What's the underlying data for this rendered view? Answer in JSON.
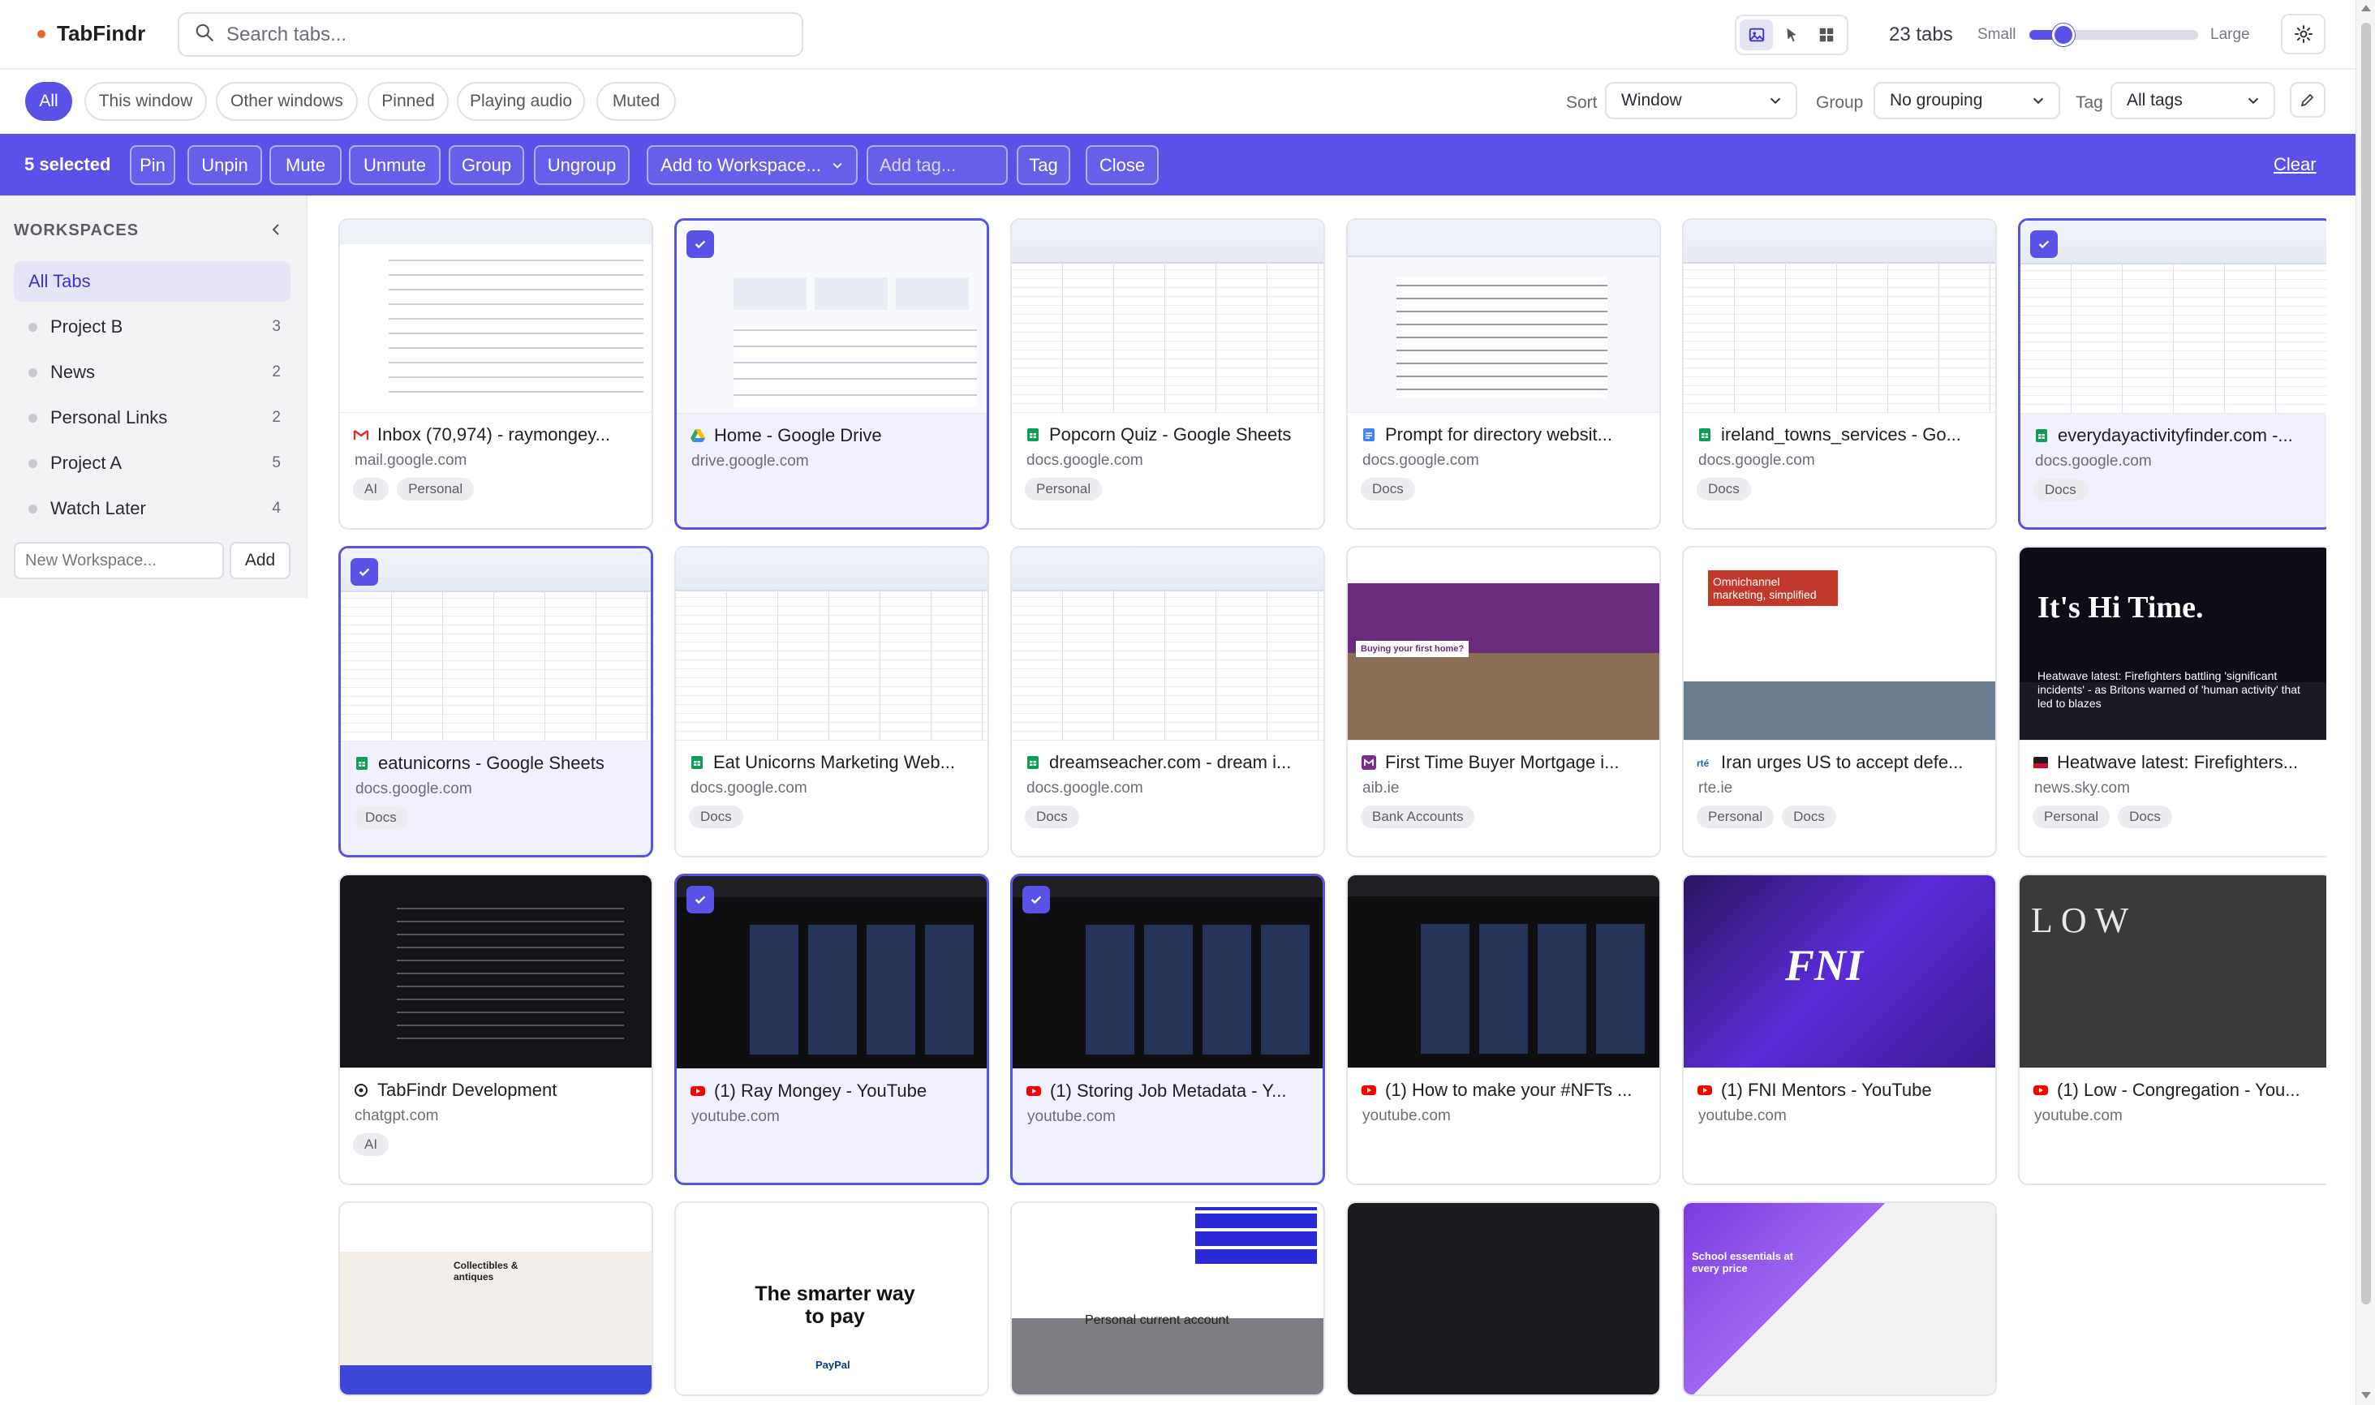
{
  "app": {
    "name": "TabFindr",
    "accent": "#5a52e6"
  },
  "search": {
    "placeholder": "Search tabs..."
  },
  "header": {
    "tab_count": "23 tabs",
    "size_small": "Small",
    "size_large": "Large",
    "size_level": 0.2
  },
  "filters": {
    "chips": [
      "All",
      "This window",
      "Other windows",
      "Pinned",
      "Playing audio",
      "Muted"
    ],
    "active_chip": "All",
    "sort_label": "Sort",
    "sort_value": "Window",
    "group_label": "Group",
    "group_value": "No grouping",
    "tag_label": "Tag",
    "tag_value": "All tags"
  },
  "selection": {
    "count_label": "5 selected",
    "actions": [
      "Pin",
      "Unpin",
      "Mute",
      "Unmute",
      "Group",
      "Ungroup"
    ],
    "workspace_dropdown": "Add to Workspace...",
    "tag_placeholder": "Add tag...",
    "tag_button": "Tag",
    "close_button": "Close",
    "clear_link": "Clear"
  },
  "sidebar": {
    "heading": "WORKSPACES",
    "items": [
      {
        "label": "All Tabs",
        "count": ""
      },
      {
        "label": "Project B",
        "count": "3"
      },
      {
        "label": "News",
        "count": "2"
      },
      {
        "label": "Personal Links",
        "count": "2"
      },
      {
        "label": "Project A",
        "count": "5"
      },
      {
        "label": "Watch Later",
        "count": "4"
      }
    ],
    "new_placeholder": "New Workspace...",
    "add_button": "Add"
  },
  "tabs": [
    {
      "title": "Inbox (70,974) - raymongey...",
      "domain": "mail.google.com",
      "tags": [
        "AI",
        "Personal"
      ],
      "selected": false,
      "favicon": "gmail-icon",
      "thumb": "mail"
    },
    {
      "title": "Home - Google Drive",
      "domain": "drive.google.com",
      "tags": [],
      "selected": true,
      "favicon": "google-drive-icon",
      "thumb": "drive"
    },
    {
      "title": "Popcorn Quiz - Google Sheets",
      "domain": "docs.google.com",
      "tags": [
        "Personal"
      ],
      "selected": false,
      "favicon": "google-sheets-icon",
      "thumb": "sheet"
    },
    {
      "title": "Prompt for directory websit...",
      "domain": "docs.google.com",
      "tags": [
        "Docs"
      ],
      "selected": false,
      "favicon": "google-docs-icon",
      "thumb": "doc"
    },
    {
      "title": "ireland_towns_services - Go...",
      "domain": "docs.google.com",
      "tags": [
        "Docs"
      ],
      "selected": false,
      "favicon": "google-sheets-icon",
      "thumb": "sheet"
    },
    {
      "title": "everydayactivityfinder.com -...",
      "domain": "docs.google.com",
      "tags": [
        "Docs"
      ],
      "selected": true,
      "favicon": "google-sheets-icon",
      "thumb": "sheet"
    },
    {
      "title": "eatunicorns - Google Sheets",
      "domain": "docs.google.com",
      "tags": [
        "Docs"
      ],
      "selected": true,
      "favicon": "google-sheets-icon",
      "thumb": "sheet"
    },
    {
      "title": "Eat Unicorns Marketing Web...",
      "domain": "docs.google.com",
      "tags": [
        "Docs"
      ],
      "selected": false,
      "favicon": "google-sheets-icon",
      "thumb": "sheet"
    },
    {
      "title": "dreamseacher.com - dream i...",
      "domain": "docs.google.com",
      "tags": [
        "Docs"
      ],
      "selected": false,
      "favicon": "google-sheets-icon",
      "thumb": "sheet"
    },
    {
      "title": "First Time Buyer Mortgage i...",
      "domain": "aib.ie",
      "tags": [
        "Bank Accounts"
      ],
      "selected": false,
      "favicon": "aib-icon",
      "thumb": "bank"
    },
    {
      "title": "Iran urges US to accept defe...",
      "domain": "rte.ie",
      "tags": [
        "Personal",
        "Docs"
      ],
      "selected": false,
      "favicon": "rte-icon",
      "thumb": "news"
    },
    {
      "title": "Heatwave latest: Firefighters...",
      "domain": "news.sky.com",
      "tags": [
        "Personal",
        "Docs"
      ],
      "selected": false,
      "favicon": "sky-news-icon",
      "thumb": "sky"
    },
    {
      "title": "TabFindr Development",
      "domain": "chatgpt.com",
      "tags": [
        "AI"
      ],
      "selected": false,
      "favicon": "chatgpt-icon",
      "thumb": "dark"
    },
    {
      "title": "(1) Ray Mongey - YouTube",
      "domain": "youtube.com",
      "tags": [],
      "selected": true,
      "favicon": "youtube-icon",
      "thumb": "yt"
    },
    {
      "title": "(1) Storing Job Metadata - Y...",
      "domain": "youtube.com",
      "tags": [],
      "selected": true,
      "favicon": "youtube-icon",
      "thumb": "yt"
    },
    {
      "title": "(1) How to make your #NFTs ...",
      "domain": "youtube.com",
      "tags": [],
      "selected": false,
      "favicon": "youtube-icon",
      "thumb": "yt"
    },
    {
      "title": "(1) FNI Mentors - YouTube",
      "domain": "youtube.com",
      "tags": [],
      "selected": false,
      "favicon": "youtube-icon",
      "thumb": "ytpurple"
    },
    {
      "title": "(1) Low - Congregation - You...",
      "domain": "youtube.com",
      "tags": [],
      "selected": false,
      "favicon": "youtube-icon",
      "thumb": "ytlow"
    },
    {
      "title": "",
      "domain": "",
      "tags": [],
      "selected": false,
      "favicon": "",
      "thumb": "ebay"
    },
    {
      "title": "",
      "domain": "",
      "tags": [],
      "selected": false,
      "favicon": "",
      "thumb": "paypal"
    },
    {
      "title": "",
      "domain": "",
      "tags": [],
      "selected": false,
      "favicon": "",
      "thumb": "cookie"
    },
    {
      "title": "",
      "domain": "",
      "tags": [],
      "selected": false,
      "favicon": "",
      "thumb": "rte"
    },
    {
      "title": "",
      "domain": "",
      "tags": [],
      "selected": false,
      "favicon": "",
      "thumb": "shop"
    }
  ],
  "thumb_text": {
    "sky_headline": "It's Hi Time.",
    "sky_news": "Heatwave latest: Firefighters battling 'significant incidents' - as Britons warned of 'human activity' that led to blazes",
    "fni_logo": "FNI",
    "low_logo": "LOW",
    "paypal_headline": "The smarter way to pay",
    "paypal_brand": "PayPal",
    "cookie_heading": "Personal current account",
    "ebay_promo": "Collectibles & antiques",
    "shop_promo": "School essentials at every price",
    "bank_promo": "Buying your first home?",
    "rte_promo": "Omnichannel marketing, simplified"
  }
}
